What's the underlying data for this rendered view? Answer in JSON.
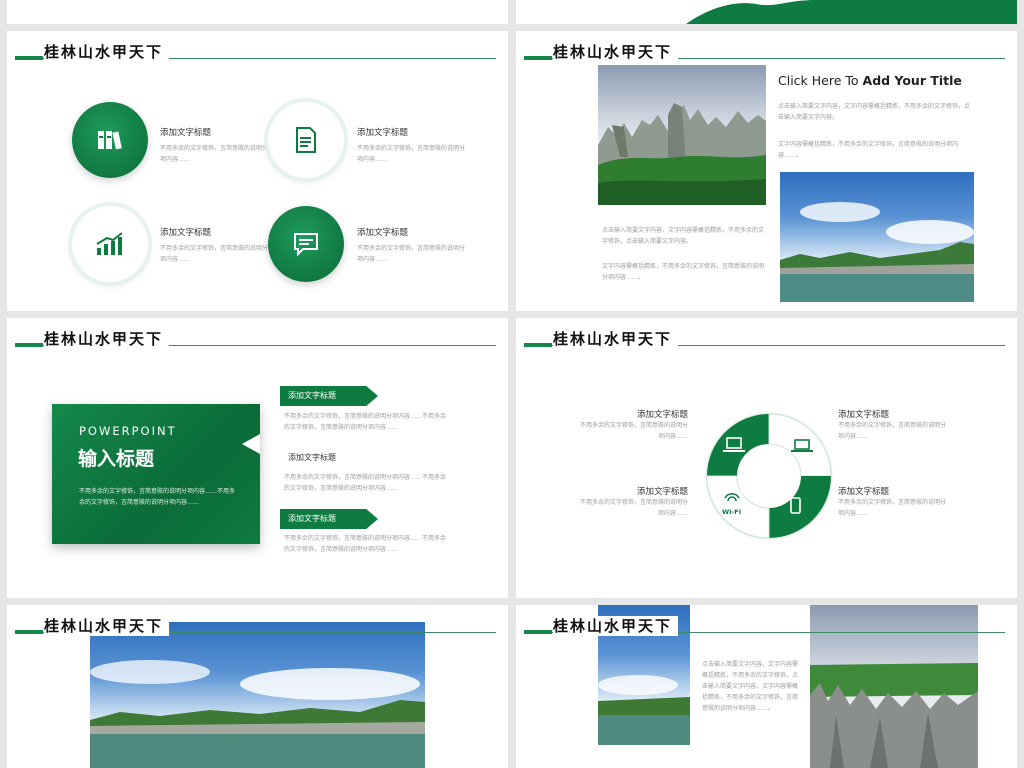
{
  "header": {
    "title": "桂林山水甲天下"
  },
  "slide1": {
    "items": [
      {
        "title": "添加文字标题",
        "desc": "不用多余的文字修饰，言简意赅的说明分项内容……",
        "icon": "books-icon"
      },
      {
        "title": "添加文字标题",
        "desc": "不用多余的文字修饰，言简意赅的说明分项内容……",
        "icon": "document-icon"
      },
      {
        "title": "添加文字标题",
        "desc": "不用多余的文字修饰，言简意赅的说明分项内容……",
        "icon": "growth-chart-icon"
      },
      {
        "title": "添加文字标题",
        "desc": "不用多余的文字修饰，言简意赅的说明分项内容……",
        "icon": "chat-bubble-icon"
      }
    ]
  },
  "slide2": {
    "title_prefix": "Click Here To ",
    "title_bold": "Add Your Title",
    "para_right_1": "点击输入简要文字内容，文字内容需概括精炼，不用多余的文字修饰，点击输入简要文字内容。",
    "para_right_2": "文字内容需概括精炼，不用多余的文字修饰，言简意赅的说明分项内容……。",
    "para_left_1": "点击输入简要文字内容，文字内容需概括精炼，不用多余的文字修饰，点击输入简要文字内容。",
    "para_left_2": "文字内容需概括精炼，不用多余的文字修饰，言简意赅的说明分项内容……。"
  },
  "slide3": {
    "box_kicker": "POWERPOINT",
    "box_title": "输入标题",
    "box_desc": "不用多余的文字修饰，言简意赅的说明分项内容……不用多余的文字修饰，言简意赅的说明分项内容……",
    "items": [
      {
        "label": "添加文字标题",
        "desc": "不用多余的文字修饰，言简意赅的说明分项内容……不用多余的文字修饰，言简意赅的说明分项内容……"
      },
      {
        "label": "添加文字标题",
        "desc": "不用多余的文字修饰，言简意赅的说明分项内容……不用多余的文字修饰，言简意赅的说明分项内容……"
      },
      {
        "label": "添加文字标题",
        "desc": "不用多余的文字修饰，言简意赅的说明分项内容……不用多余的文字修饰，言简意赅的说明分项内容……"
      }
    ]
  },
  "slide4": {
    "wifi_label": "WI-FI",
    "items": [
      {
        "title": "添加文字标题",
        "desc": "不用多余的文字修饰，言简意赅的说明分项内容……"
      },
      {
        "title": "添加文字标题",
        "desc": "不用多余的文字修饰，言简意赅的说明分项内容……"
      },
      {
        "title": "添加文字标题",
        "desc": "不用多余的文字修饰，言简意赅的说明分项内容……"
      },
      {
        "title": "添加文字标题",
        "desc": "不用多余的文字修饰，言简意赅的说明分项内容……"
      }
    ]
  },
  "slide6": {
    "para": "点击输入简要文字内容，文字内容需概括精炼，不用多余的文字修饰，点击输入简要文字内容。文字内容需概括精炼，不用多余的文字修饰，言简意赅的说明分项内容……。"
  },
  "colors": {
    "accent": "#0e7b41",
    "accent_light": "#e6f3ec"
  }
}
